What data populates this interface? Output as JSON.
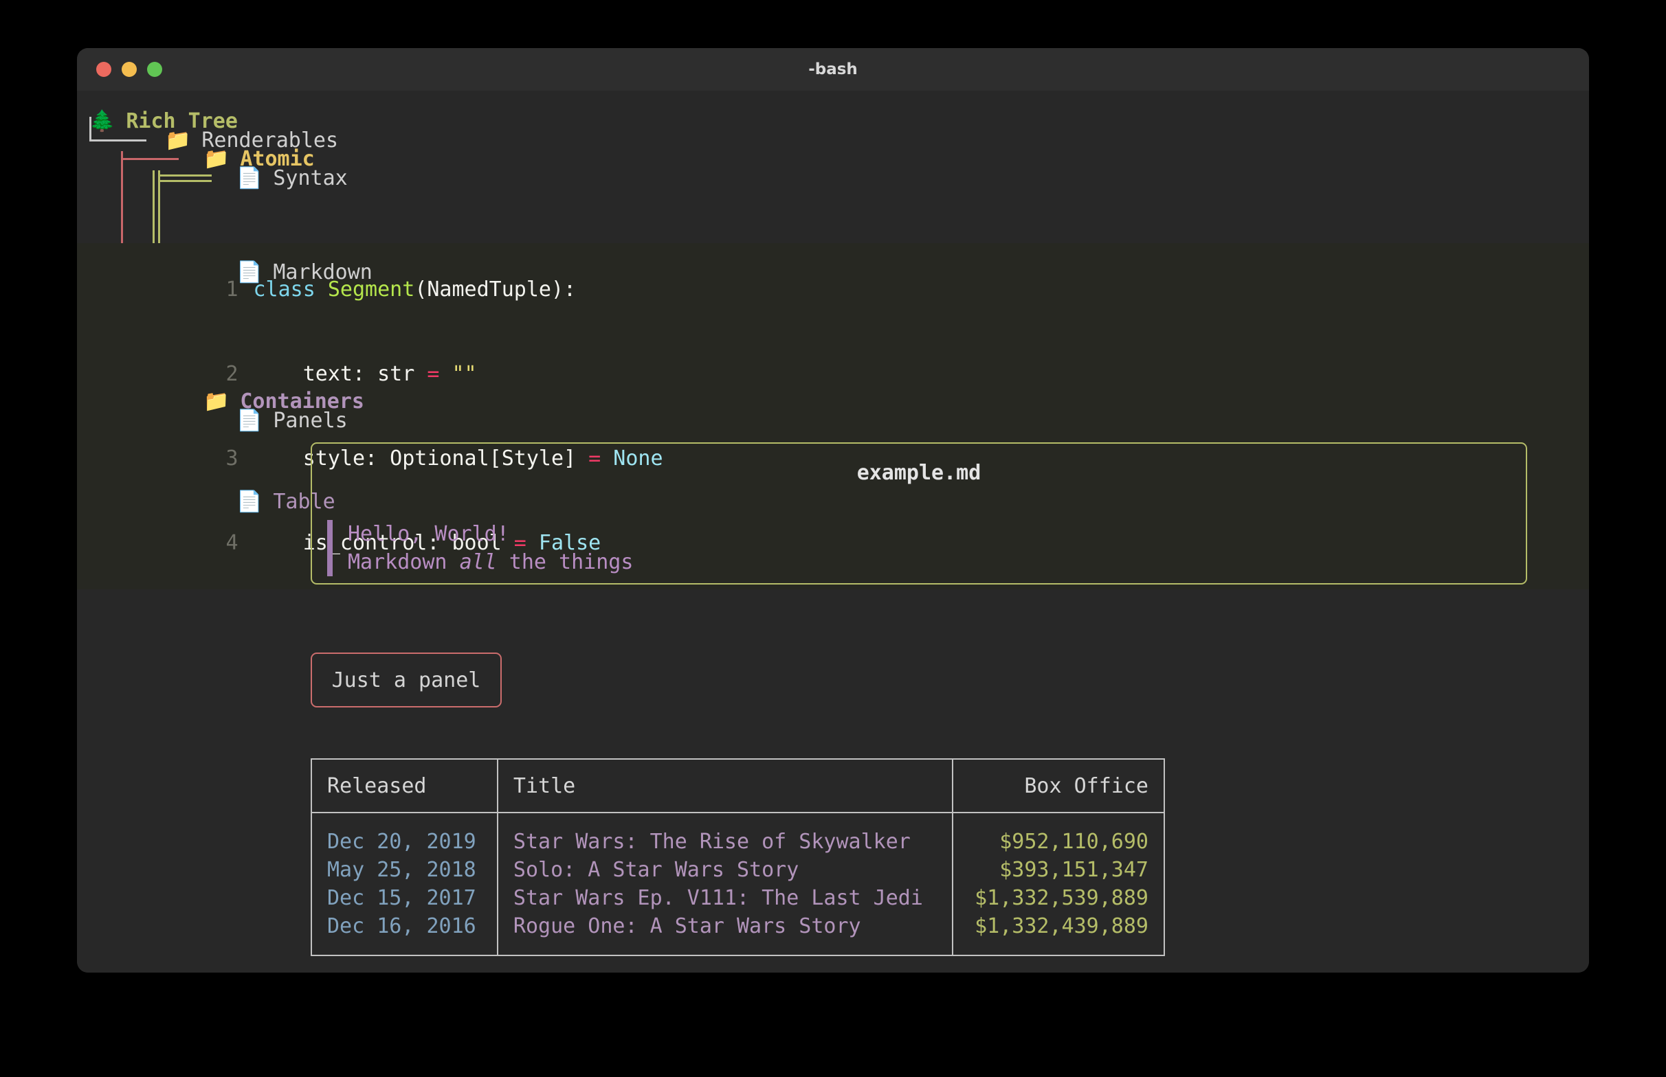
{
  "window": {
    "title": "-bash",
    "traffic_lights": [
      "close-red",
      "minimize-yellow",
      "zoom-green"
    ]
  },
  "tree": {
    "root": {
      "icon": "🌲",
      "label": "Rich Tree"
    },
    "renderables": {
      "icon": "📁",
      "label": "Renderables"
    },
    "atomic": {
      "icon": "📁",
      "label": "Atomic"
    },
    "syntax": {
      "icon": "📄",
      "label": "Syntax"
    },
    "markdown": {
      "icon": "📄",
      "label": "Markdown"
    },
    "containers": {
      "icon": "📁",
      "label": "Containers"
    },
    "panels": {
      "icon": "📄",
      "label": "Panels"
    },
    "table": {
      "icon": "📄",
      "label": "Table"
    }
  },
  "code": {
    "lines": [
      {
        "n": "1",
        "text": "class Segment(NamedTuple):"
      },
      {
        "n": "2",
        "text": "    text: str = \"\""
      },
      {
        "n": "3",
        "text": "    style: Optional[Style] = None"
      },
      {
        "n": "4",
        "text": "    is_control: bool = False"
      }
    ],
    "tokens": {
      "l1_kw": "class",
      "l1_sp1": " ",
      "l1_cls": "Segment",
      "l1_rest": "(NamedTuple):",
      "l2_pln": "    text: str ",
      "l2_op": "=",
      "l2_sp": " ",
      "l2_str": "\"\"",
      "l3_pln": "    style: Optional[Style] ",
      "l3_op": "=",
      "l3_sp": " ",
      "l3_lit": "None",
      "l4_pln": "    is_control: bool ",
      "l4_op": "=",
      "l4_sp": " ",
      "l4_lit": "False"
    }
  },
  "markdown_panel": {
    "title": "example.md",
    "quote_line1": "Hello, World!",
    "quote_line2_a": "Markdown ",
    "quote_line2_em": "all",
    "quote_line2_b": " the things"
  },
  "just_panel": {
    "text": "Just a panel"
  },
  "table": {
    "headers": [
      "Released",
      "Title",
      "Box Office"
    ],
    "rows": [
      {
        "released": "Dec 20, 2019",
        "title": "Star Wars: The Rise of Skywalker",
        "box_office": "$952,110,690",
        "style": "bright"
      },
      {
        "released": "May 25, 2018",
        "title": "Solo: A Star Wars Story",
        "box_office": "$393,151,347",
        "style": "dim"
      },
      {
        "released": "Dec 15, 2017",
        "title": "Star Wars Ep. V111: The Last Jedi",
        "box_office": "$1,332,539,889",
        "style": "bright"
      },
      {
        "released": "Dec 16, 2016",
        "title": "Rogue One: A Star Wars Story",
        "box_office": "$1,332,439,889",
        "style": "dim"
      }
    ]
  },
  "colors": {
    "background": "#282828",
    "code_background": "#272822",
    "root_label": "#b5bd68",
    "atomic_label": "#e6c564",
    "containers_label": "#b294bb",
    "guide_white": "#c8c8c8",
    "guide_salmon": "#c9676a",
    "guide_olive": "#b5bd68",
    "guide_purple": "#9a7fb0",
    "panel_border_md": "#b5bd68",
    "panel_border_red": "#cb6d6d",
    "table_border": "#c2c2c2",
    "col_released": "#81a2be",
    "col_title": "#b294bb",
    "col_box_office": "#b5bd68"
  }
}
